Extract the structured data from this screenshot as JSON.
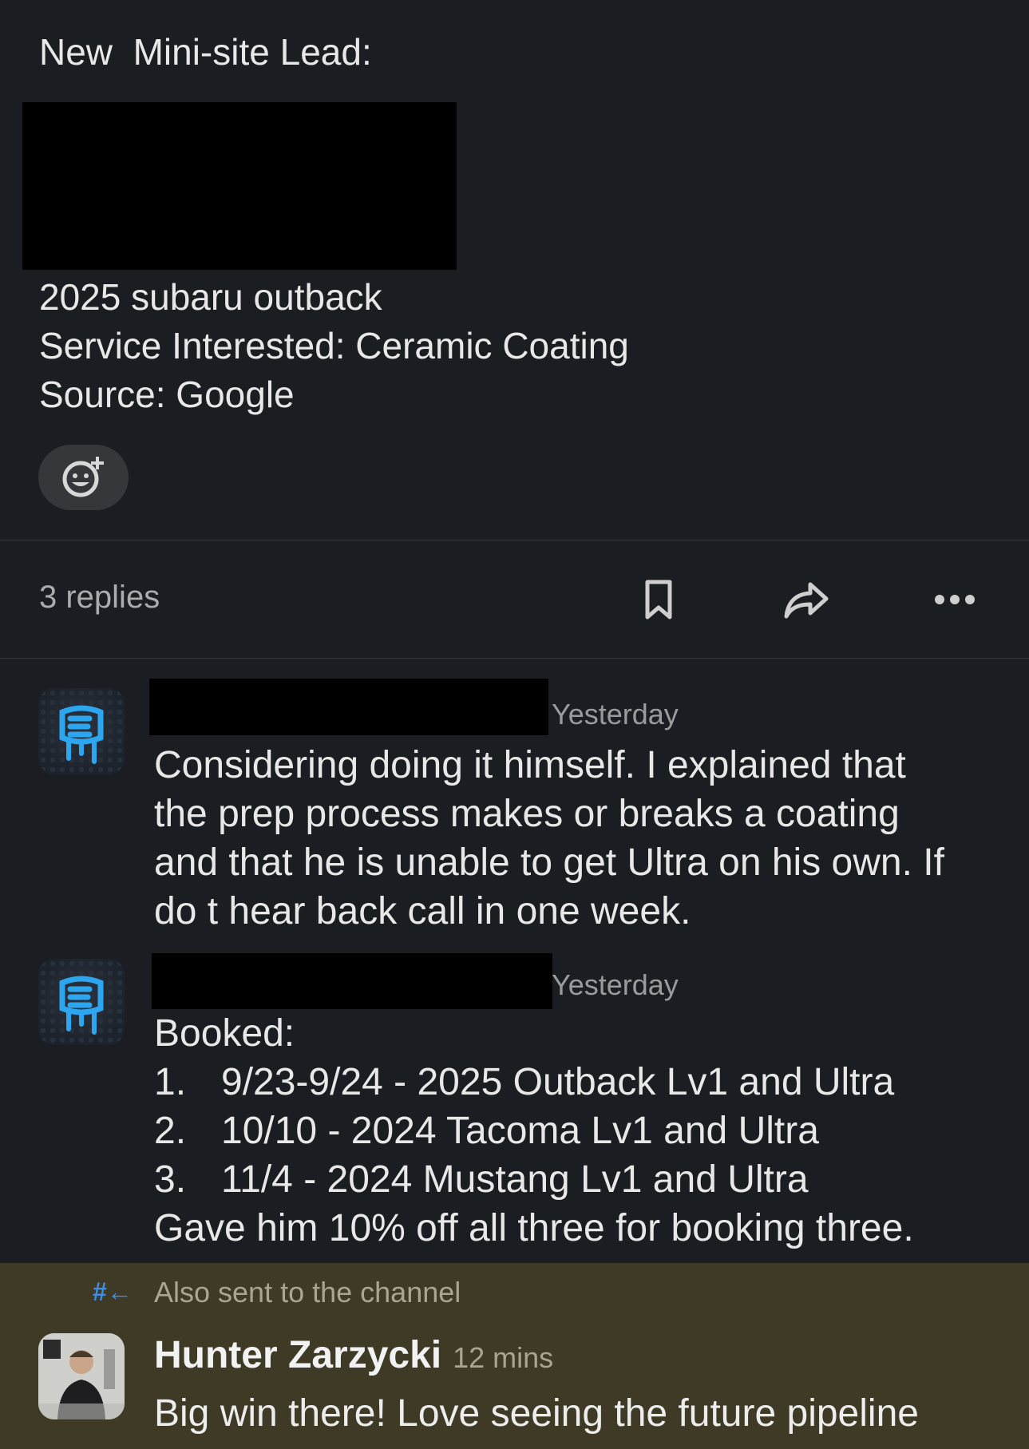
{
  "parent": {
    "title": "New  Mini-site Lead:",
    "lines": [
      "2025 subaru outback",
      "Service Interested: Ceramic Coating",
      "Source: Google"
    ]
  },
  "thread_bar": {
    "replies_label": "3 replies",
    "icons": [
      "bookmark-icon",
      "share-icon",
      "more-icon"
    ]
  },
  "replies": [
    {
      "timestamp": "Yesterday",
      "lines": [
        "Considering doing it himself. I explained that",
        "the prep process makes or breaks a coating",
        "and that he is unable to get Ultra on his own. If",
        "do t hear back call in one week."
      ]
    },
    {
      "timestamp": "Yesterday",
      "intro": "Booked:",
      "list": [
        {
          "num": "1.",
          "text": "9/23-9/24 - 2025 Outback Lv1 and Ultra"
        },
        {
          "num": "2.",
          "text": "10/10 - 2024 Tacoma Lv1 and Ultra"
        },
        {
          "num": "3.",
          "text": "11/4 - 2024 Mustang Lv1 and Ultra"
        }
      ],
      "outro": "Gave him 10% off all three for booking three."
    }
  ],
  "channel_reply": {
    "also_sent_label": "Also sent to the channel",
    "author": "Hunter Zarzycki",
    "timestamp": "12 mins",
    "text": "Big win there! Love seeing the future pipeline"
  },
  "colors": {
    "background": "#1a1d21",
    "channel_highlight": "#3f3a26",
    "accent_blue": "#3d8ee8"
  }
}
